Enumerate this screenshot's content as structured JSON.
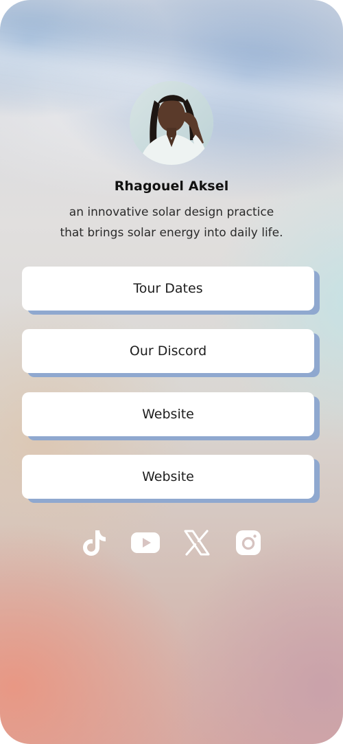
{
  "profile": {
    "name": "Rhagouel Aksel",
    "bio_line1": "an innovative solar design practice",
    "bio_line2": "that brings solar energy into daily life.",
    "avatar_icon": "profile-photo"
  },
  "links": [
    {
      "label": "Tour Dates"
    },
    {
      "label": "Our Discord"
    },
    {
      "label": "Website"
    },
    {
      "label": "Website"
    }
  ],
  "socials": [
    {
      "icon": "tiktok-icon"
    },
    {
      "icon": "youtube-icon"
    },
    {
      "icon": "x-icon"
    },
    {
      "icon": "instagram-icon"
    }
  ],
  "colors": {
    "button_bg": "#ffffff",
    "button_shadow": "#8fa8cf",
    "icon_color": "#ffffff",
    "text_dark": "#111111"
  }
}
